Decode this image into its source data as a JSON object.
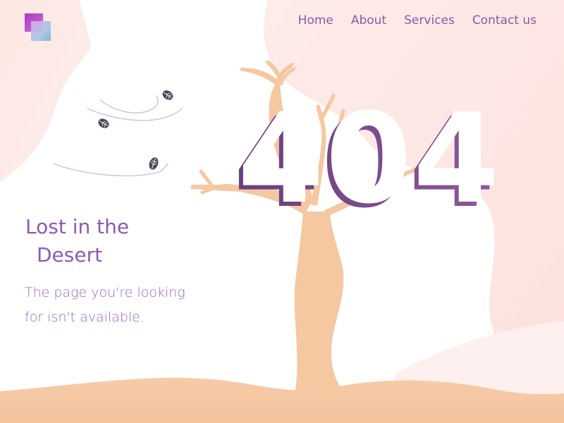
{
  "logo": {
    "icon": "logo-squares-icon",
    "colors": [
      "#a23fc0",
      "#e1a7e6",
      "#7fb3c8"
    ]
  },
  "nav": {
    "items": [
      {
        "label": "Home"
      },
      {
        "label": "About"
      },
      {
        "label": "Services"
      },
      {
        "label": "Contact us"
      }
    ]
  },
  "error": {
    "code": "404"
  },
  "message": {
    "title_line1": "Lost in the",
    "title_line2": "Desert",
    "subtitle": "The page you're looking for isn't available."
  },
  "illustration": {
    "tree": "tree-icon",
    "leaves": [
      "leaf-icon",
      "leaf-icon",
      "leaf-icon"
    ],
    "wind": "wind-lines-icon",
    "colors": {
      "accent": "#8e5ab3",
      "code": "#6e4682",
      "sand": "#f6c9a4",
      "tree": "#f4c7a1",
      "blush": "#fde3e1"
    }
  }
}
